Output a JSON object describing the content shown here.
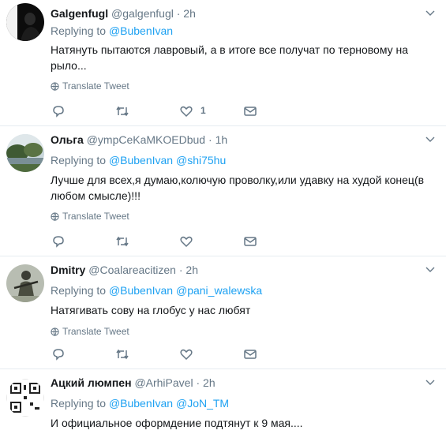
{
  "tweets": [
    {
      "name": "Galgenfugl",
      "handle": "@galgenfugl",
      "dot": "·",
      "time": "2h",
      "replying_prefix": "Replying to",
      "mentions": [
        "@BubenIvan"
      ],
      "text": "Натянуть пытаются лавровый, а в итоге все получат по терновому на рыло...",
      "translate": "Translate Tweet",
      "like_count": "1",
      "avatar": "dark-figure-avatar"
    },
    {
      "name": "Ольга",
      "handle": "@ympCeKaMKOEDbud",
      "dot": "·",
      "time": "1h",
      "replying_prefix": "Replying to",
      "mentions": [
        "@BubenIvan",
        "@shi75hu"
      ],
      "text": "Лучше для всех,я думаю,колючую проволку,или удавку на худой конец(в любом смысле)!!!",
      "translate": "Translate Tweet",
      "like_count": "",
      "avatar": "landscape-avatar"
    },
    {
      "name": "Dmitry",
      "handle": "@Coalareacitizen",
      "dot": "·",
      "time": "2h",
      "replying_prefix": "Replying to",
      "mentions": [
        "@BubenIvan",
        "@pani_walewska"
      ],
      "text": "Натягивать сову на глобус у нас любят",
      "translate": "Translate Tweet",
      "like_count": "",
      "avatar": "soldier-avatar"
    },
    {
      "name": "Ацкий люмпен",
      "handle": "@ArhiPavel",
      "dot": "·",
      "time": "2h",
      "replying_prefix": "Replying to",
      "mentions": [
        "@BubenIvan",
        "@JoN_TM"
      ],
      "text": "И официальное оформдение подтянут к 9 мая....",
      "translate": "",
      "like_count": "",
      "avatar": "qr-pattern-avatar"
    }
  ],
  "colors": {
    "link": "#1da1f2",
    "muted": "#657786",
    "divider": "#e6ecf0"
  }
}
